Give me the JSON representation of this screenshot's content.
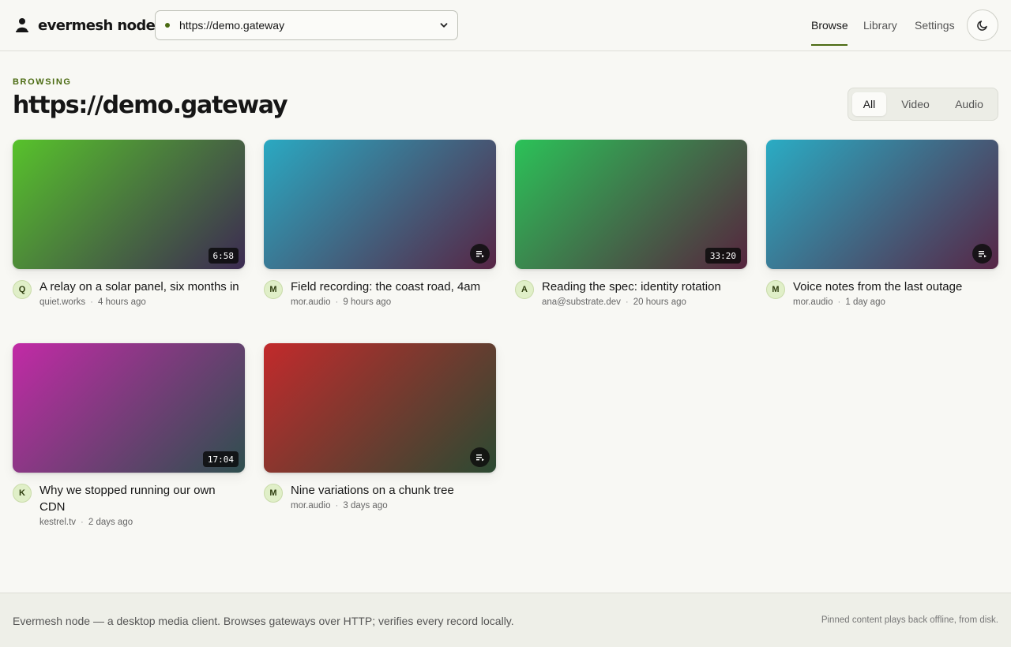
{
  "app": {
    "name": "evermesh node"
  },
  "gateway": {
    "selected": "https://demo.gateway"
  },
  "nav": {
    "browse": "Browse",
    "library": "Library",
    "settings": "Settings"
  },
  "heading": {
    "eyebrow": "BROWSING",
    "title": "https://demo.gateway"
  },
  "filters": {
    "all": "All",
    "video": "Video",
    "audio": "Audio",
    "selected": "All"
  },
  "items": [
    {
      "title": "A relay on a solar panel, six months in",
      "author": "quiet.works",
      "avatar": "Q",
      "age": "4 hours ago",
      "kind": "video",
      "duration": "6:58",
      "gradient": [
        "#57c22b",
        "#3c2a52"
      ]
    },
    {
      "title": "Field recording: the coast road, 4am",
      "author": "mor.audio",
      "avatar": "M",
      "age": "9 hours ago",
      "kind": "audio",
      "gradient": [
        "#2aa9c2",
        "#572545"
      ]
    },
    {
      "title": "Reading the spec: identity rotation",
      "author": "ana@substrate.dev",
      "avatar": "A",
      "age": "20 hours ago",
      "kind": "video",
      "duration": "33:20",
      "gradient": [
        "#2bc258",
        "#56243e"
      ]
    },
    {
      "title": "Voice notes from the last outage",
      "author": "mor.audio",
      "avatar": "M",
      "age": "1 day ago",
      "kind": "audio",
      "gradient": [
        "#2aacc4",
        "#572646"
      ]
    },
    {
      "title": "Why we stopped running our own CDN",
      "author": "kestrel.tv",
      "avatar": "K",
      "age": "2 days ago",
      "kind": "video",
      "duration": "17:04",
      "gradient": [
        "#c22aa6",
        "#2e4f4e"
      ]
    },
    {
      "title": "Nine variations on a chunk tree",
      "author": "mor.audio",
      "avatar": "M",
      "age": "3 days ago",
      "kind": "audio",
      "gradient": [
        "#c22a2c",
        "#2b4a32"
      ]
    }
  ],
  "footer": {
    "left": "Evermesh node — a desktop media client. Browses gateways over HTTP; verifies every record locally.",
    "right": "Pinned content plays back offline, from disk."
  },
  "colors": {
    "accent": "#4b6b12",
    "background": "#f8f8f4"
  },
  "icons": {
    "theme": "moon-icon",
    "audio": "playlist-icon",
    "logo": "node-logo-icon"
  }
}
